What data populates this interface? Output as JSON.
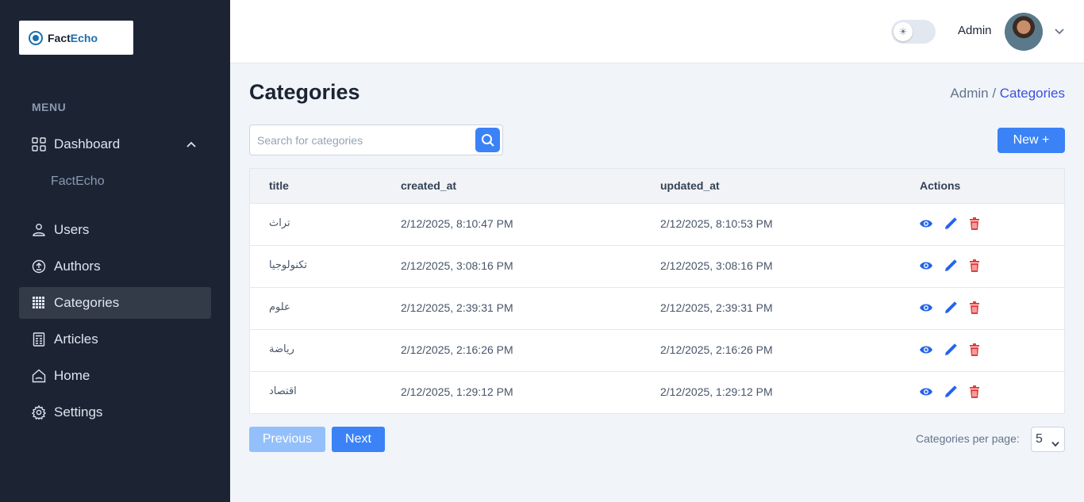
{
  "brand": {
    "name_part1": "Fact",
    "name_part2": "Echo"
  },
  "sidebar": {
    "menu_title": "MENU",
    "items": [
      {
        "label": "Dashboard",
        "icon": "dashboard-grid-icon"
      },
      {
        "label": "Users",
        "icon": "user-icon"
      },
      {
        "label": "Authors",
        "icon": "author-icon"
      },
      {
        "label": "Categories",
        "icon": "categories-grid-icon"
      },
      {
        "label": "Articles",
        "icon": "articles-icon"
      },
      {
        "label": "Home",
        "icon": "home-icon"
      },
      {
        "label": "Settings",
        "icon": "gear-icon"
      }
    ],
    "dashboard_sub": "FactEcho",
    "active": "Categories"
  },
  "header": {
    "user_name": "Admin",
    "theme_toggle": "light"
  },
  "main": {
    "title": "Categories",
    "breadcrumb": {
      "root": "Admin /",
      "current": "Categories"
    },
    "search": {
      "placeholder": "Search for categories",
      "value": ""
    },
    "new_button": "New +",
    "table": {
      "columns": [
        "title",
        "created_at",
        "updated_at",
        "Actions"
      ],
      "rows": [
        {
          "title": "تراث",
          "created_at": "2/12/2025, 8:10:47 PM",
          "updated_at": "2/12/2025, 8:10:53 PM"
        },
        {
          "title": "تكنولوجيا",
          "created_at": "2/12/2025, 3:08:16 PM",
          "updated_at": "2/12/2025, 3:08:16 PM"
        },
        {
          "title": "علوم",
          "created_at": "2/12/2025, 2:39:31 PM",
          "updated_at": "2/12/2025, 2:39:31 PM"
        },
        {
          "title": "رياضة",
          "created_at": "2/12/2025, 2:16:26 PM",
          "updated_at": "2/12/2025, 2:16:26 PM"
        },
        {
          "title": "اقتصاد",
          "created_at": "2/12/2025, 1:29:12 PM",
          "updated_at": "2/12/2025, 1:29:12 PM"
        }
      ]
    },
    "pagination": {
      "previous": "Previous",
      "next": "Next",
      "per_page_label": "Categories per page:",
      "per_page_value": "5"
    }
  },
  "colors": {
    "sidebar_bg": "#1c2434",
    "primary": "#3b82f6",
    "delete": "#e53e3e",
    "breadcrumb_accent": "#3c50e0"
  }
}
